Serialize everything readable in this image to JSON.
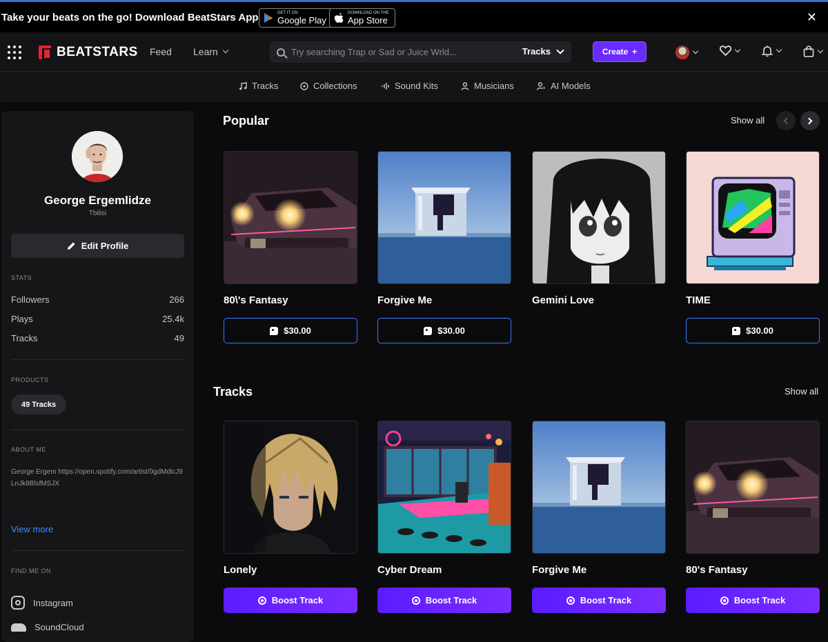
{
  "promo": {
    "text": "Take your beats on the go! Download BeatStars App",
    "google_small": "GET IT ON",
    "google_big": "Google Play",
    "apple_small": "Download on the",
    "apple_big": "App Store"
  },
  "header": {
    "brand": "BEATSTARS",
    "nav": [
      "Feed",
      "Learn"
    ],
    "search_placeholder": "Try searching Trap or Sad or Juice Wrld...",
    "search_type": "Tracks",
    "create_label": "Create",
    "create_plus": "+"
  },
  "subnav": [
    "Tracks",
    "Collections",
    "Sound Kits",
    "Musicians",
    "AI Models"
  ],
  "profile": {
    "name": "George Ergemlidze",
    "location": "Tbilisi",
    "edit_label": "Edit Profile",
    "stats_label": "STATS",
    "stats": [
      {
        "label": "Followers",
        "value": "266"
      },
      {
        "label": "Plays",
        "value": "25.4k"
      },
      {
        "label": "Tracks",
        "value": "49"
      }
    ],
    "products_label": "PRODUCTS",
    "products_pill": "49 Tracks",
    "about_label": "ABOUT ME",
    "about_text": "George Ergem https://open.spotify.com/artist/0gdMdlcJ9LnJk8BlsfMSJX",
    "view_more": "View more",
    "find_label": "FIND ME ON",
    "socials": [
      "Instagram",
      "SoundCloud"
    ]
  },
  "popular": {
    "title": "Popular",
    "show_all": "Show all",
    "items": [
      {
        "title": "80\\'s Fantasy",
        "price": "$30.00",
        "art": "car"
      },
      {
        "title": "Forgive Me",
        "price": "$30.00",
        "art": "sea"
      },
      {
        "title": "Gemini Love",
        "price": "",
        "art": "anime-girl"
      },
      {
        "title": "TIME",
        "price": "$30.00",
        "art": "tv"
      }
    ]
  },
  "tracks": {
    "title": "Tracks",
    "show_all": "Show all",
    "boost_label": "Boost Track",
    "items": [
      {
        "title": "Lonely",
        "art": "anime-boy"
      },
      {
        "title": "Cyber Dream",
        "art": "diner"
      },
      {
        "title": "Forgive Me",
        "art": "sea"
      },
      {
        "title": "80's Fantasy",
        "art": "car"
      }
    ]
  },
  "colors": {
    "accent_purple": "#6a2bff",
    "link_blue": "#3c8cff",
    "brand_red": "#e8232f"
  },
  "icons": [
    "grid-menu-icon",
    "search-icon",
    "heart-icon",
    "bell-icon",
    "bag-icon",
    "pencil-icon",
    "instagram-icon",
    "soundcloud-icon",
    "tag-icon",
    "boost-icon"
  ]
}
